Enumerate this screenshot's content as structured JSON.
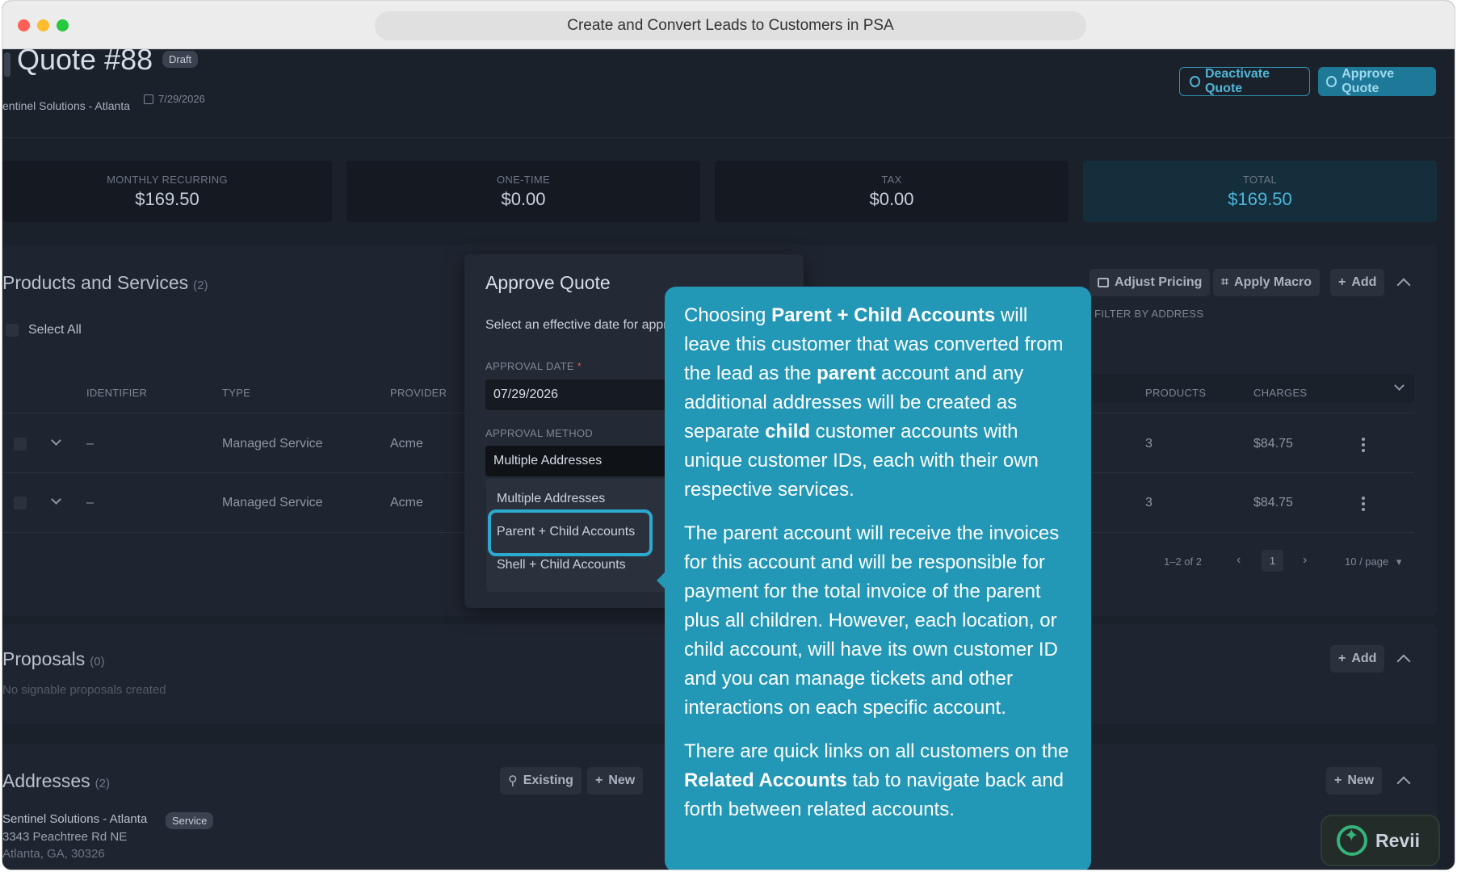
{
  "window": {
    "title": "Create and Convert Leads to Customers in PSA"
  },
  "quote": {
    "title": "Quote #88",
    "status_badge": "Draft",
    "company": "entinel Solutions - Atlanta",
    "date": "7/29/2026",
    "deactivate_label": "Deactivate Quote",
    "approve_label": "Approve Quote"
  },
  "stats": [
    {
      "label": "MONTHLY RECURRING",
      "value": "$169.50"
    },
    {
      "label": "ONE-TIME",
      "value": "$0.00"
    },
    {
      "label": "TAX",
      "value": "$0.00"
    },
    {
      "label": "TOTAL",
      "value": "$169.50"
    }
  ],
  "products": {
    "title": "Products and Services",
    "count": "(2)",
    "select_all": "Select All",
    "adjust_pricing": "Adjust Pricing",
    "apply_macro": "Apply Macro",
    "add": "Add",
    "filter_label": "FILTER BY ADDRESS",
    "columns": {
      "identifier": "IDENTIFIER",
      "type": "TYPE",
      "provider": "PROVIDER",
      "products": "PRODUCTS",
      "charges": "CHARGES"
    },
    "rows": [
      {
        "identifier": "–",
        "type": "Managed Service",
        "provider": "Acme",
        "products": "3",
        "charges": "$84.75"
      },
      {
        "identifier": "–",
        "type": "Managed Service",
        "provider": "Acme",
        "products": "3",
        "charges": "$84.75"
      }
    ],
    "pagination": {
      "range": "1–2 of 2",
      "page": "1",
      "per_page": "10 / page"
    }
  },
  "proposals": {
    "title": "Proposals",
    "count": "(0)",
    "empty": "No signable proposals created",
    "add": "Add"
  },
  "addresses": {
    "title": "Addresses",
    "count": "(2)",
    "existing": "Existing",
    "new": "New",
    "new_right": "New",
    "item": {
      "name": "Sentinel Solutions - Atlanta",
      "badge": "Service",
      "line1": "3343 Peachtree Rd NE",
      "line2": "Atlanta, GA, 30326"
    }
  },
  "modal": {
    "title": "Approve Quote",
    "description": "Select an effective date for appr",
    "date_label": "APPROVAL DATE",
    "date_required": "*",
    "date_value": "07/29/2026",
    "method_label": "APPROVAL METHOD",
    "method_value": "Multiple Addresses",
    "options": [
      "Multiple Addresses",
      "Parent + Child Accounts",
      "Shell + Child Accounts"
    ]
  },
  "callout": {
    "p1": {
      "a": "Choosing ",
      "b": "Parent + Child Accounts",
      "c": " will leave this customer that was converted from the lead as the ",
      "d": "parent",
      "e": " account and any additional addresses will be created as separate ",
      "f": "child",
      "g": " customer accounts with unique customer IDs, each with their own respective services."
    },
    "p2": "The parent account will receive the invoices for this account and will be responsible for payment for the total invoice of the parent plus all children. However, each location, or child account, will have its own customer ID and you can manage tickets and other interactions on each specific account.",
    "p3": {
      "a": "There are quick links on all customers on the ",
      "b": "Related Accounts",
      "c": " tab to navigate back and forth between related accounts."
    }
  },
  "widget": {
    "label": "Revii"
  },
  "colors": {
    "accent": "#2397b6",
    "background": "#1b212b",
    "total_value": "#4db6dc"
  }
}
